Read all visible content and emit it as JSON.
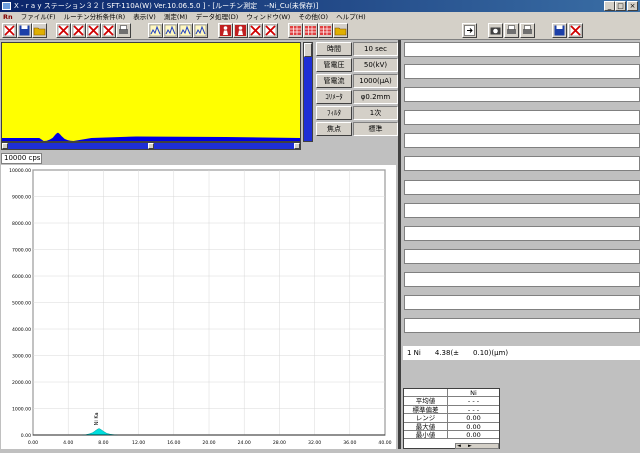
{
  "window": {
    "title": "X - r a y  ステーション３２ [ SFT-110A(W) Ver.10.06.5.0 ] - [ルーチン測定　--Ni_Cu(未保存)]",
    "buttons": [
      "_",
      "□",
      "×"
    ]
  },
  "menu": {
    "app_badge": "Rn",
    "items": [
      "ファイル(F)",
      "ルーチン分析条件(R)",
      "表示(V)",
      "測定(M)",
      "データ処理(D)",
      "ウィンドウ(W)",
      "その他(O)",
      "ヘルプ(H)"
    ]
  },
  "colors": {
    "spectrum_bg": "#ffff00",
    "spectrum_fill": "#0000e0",
    "peak_fill": "#00dede",
    "titlebar": "#0a246a",
    "chrome": "#d4d0c8"
  },
  "toolbar_icons": [
    "new-routine-icon",
    "save-icon",
    "open-icon",
    "delete-x-icon",
    "delete-x-icon",
    "delete-x-icon",
    "delete-x-icon",
    "print-icon",
    "peak-search-icon",
    "spectrum-icon",
    "overlay-icon",
    "calibration-icon",
    "sample-icon",
    "operator-icon",
    "delete-x-icon",
    "delete-x-icon",
    "element-table-icon",
    "element-edit-icon",
    "element-add-icon",
    "folder-icon",
    "export-icon",
    "camera-icon",
    "printer-icon",
    "printer-icon",
    "save-disk-icon",
    "close-x-icon"
  ],
  "params": [
    {
      "label": "時間",
      "value": "10 sec"
    },
    {
      "label": "管電圧",
      "value": "50(kV)"
    },
    {
      "label": "管電流",
      "value": "1000(μA)"
    },
    {
      "label": "ｺﾘﾒｰﾀ",
      "value": "φ0.2mm"
    },
    {
      "label": "ﾌｨﾙﾀ",
      "value": "1次"
    },
    {
      "label": "焦点",
      "value": "標準"
    }
  ],
  "cps_scale": "10000 cps",
  "chart_data": {
    "type": "area",
    "title": "",
    "xlabel": "",
    "ylabel": "",
    "xlim": [
      0,
      40
    ],
    "ylim": [
      0,
      10000
    ],
    "x_ticks": [
      "0.00",
      "4.00",
      "8.00",
      "12.00",
      "16.00",
      "20.00",
      "24.00",
      "28.00",
      "32.00",
      "36.00",
      "40.00"
    ],
    "y_ticks": [
      "0.00",
      "1000.00",
      "2000.00",
      "3000.00",
      "4000.00",
      "5000.00",
      "6000.00",
      "7000.00",
      "8000.00",
      "9000.00",
      "10000.00"
    ],
    "grid": true,
    "peak_annotation": {
      "label": "Ni Ka",
      "x": 7.48
    },
    "series": [
      {
        "x": [
          5.6,
          6.0,
          6.4,
          6.8,
          7.0,
          7.2,
          7.4,
          7.5,
          7.6,
          7.8,
          8.0,
          8.2,
          8.4,
          8.8,
          9.2,
          9.6
        ],
        "values": [
          0,
          10,
          40,
          90,
          140,
          190,
          230,
          240,
          230,
          190,
          140,
          100,
          60,
          25,
          10,
          0
        ]
      }
    ]
  },
  "result": {
    "line": "1 Ni　　4.38(±　　0.10)(μm)"
  },
  "stats": {
    "header": "Ni",
    "rows": [
      {
        "label": "平均値",
        "value": "- - -"
      },
      {
        "label": "標準偏差",
        "value": "- - -"
      },
      {
        "label": "レンジ",
        "value": "0.00"
      },
      {
        "label": "最大値",
        "value": "0.00"
      },
      {
        "label": "最小値",
        "value": "0.00"
      }
    ],
    "scroll_arrows": [
      "◄",
      "►"
    ]
  }
}
